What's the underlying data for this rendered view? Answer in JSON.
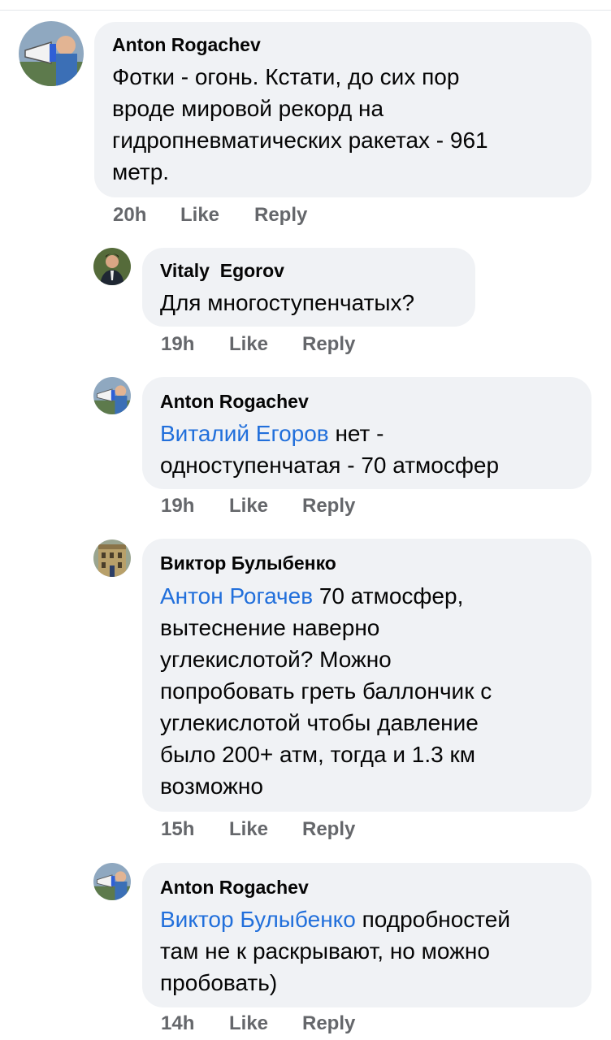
{
  "colors": {
    "bubble": "#f0f2f5",
    "mention": "#216fdb",
    "meta": "#65676b",
    "text": "#050505"
  },
  "actions": {
    "like": "Like",
    "reply": "Reply"
  },
  "comments": [
    {
      "author": "Anton Rogachev",
      "avatar": "megaphone-avatar-icon",
      "lines": [
        "Фотки - огонь. Кстати, до сих пор",
        "вроде мировой рекорд на",
        "гидропневматических ракетах - 961",
        "метр."
      ],
      "time": "20h"
    },
    {
      "author": "Vitaly  Egorov",
      "avatar": "man-in-suit-avatar-icon",
      "lines": [
        "Для многоступенчатых?"
      ],
      "time": "19h"
    },
    {
      "author": "Anton Rogachev",
      "avatar": "megaphone-avatar-icon",
      "mention": "Виталий Егоров",
      "lines": [
        " нет  -",
        "одноступенчатая - 70 атмосфер"
      ],
      "time": "19h"
    },
    {
      "author": "Виктор Булыбенко",
      "avatar": "building-avatar-icon",
      "mention": "Антон Рогачев",
      "lines": [
        " 70 атмосфер,",
        "вытеснение наверно",
        "углекислотой? Можно",
        "попробовать греть баллончик с",
        "углекислотой чтобы давление",
        "было 200+ атм, тогда и 1.3 км",
        "возможно"
      ],
      "time": "15h"
    },
    {
      "author": "Anton Rogachev",
      "avatar": "megaphone-avatar-icon",
      "mention": "Виктор Булыбенко",
      "lines": [
        " подробностей",
        "там не к раскрывают, но можно",
        "пробовать)"
      ],
      "time": "14h"
    }
  ]
}
